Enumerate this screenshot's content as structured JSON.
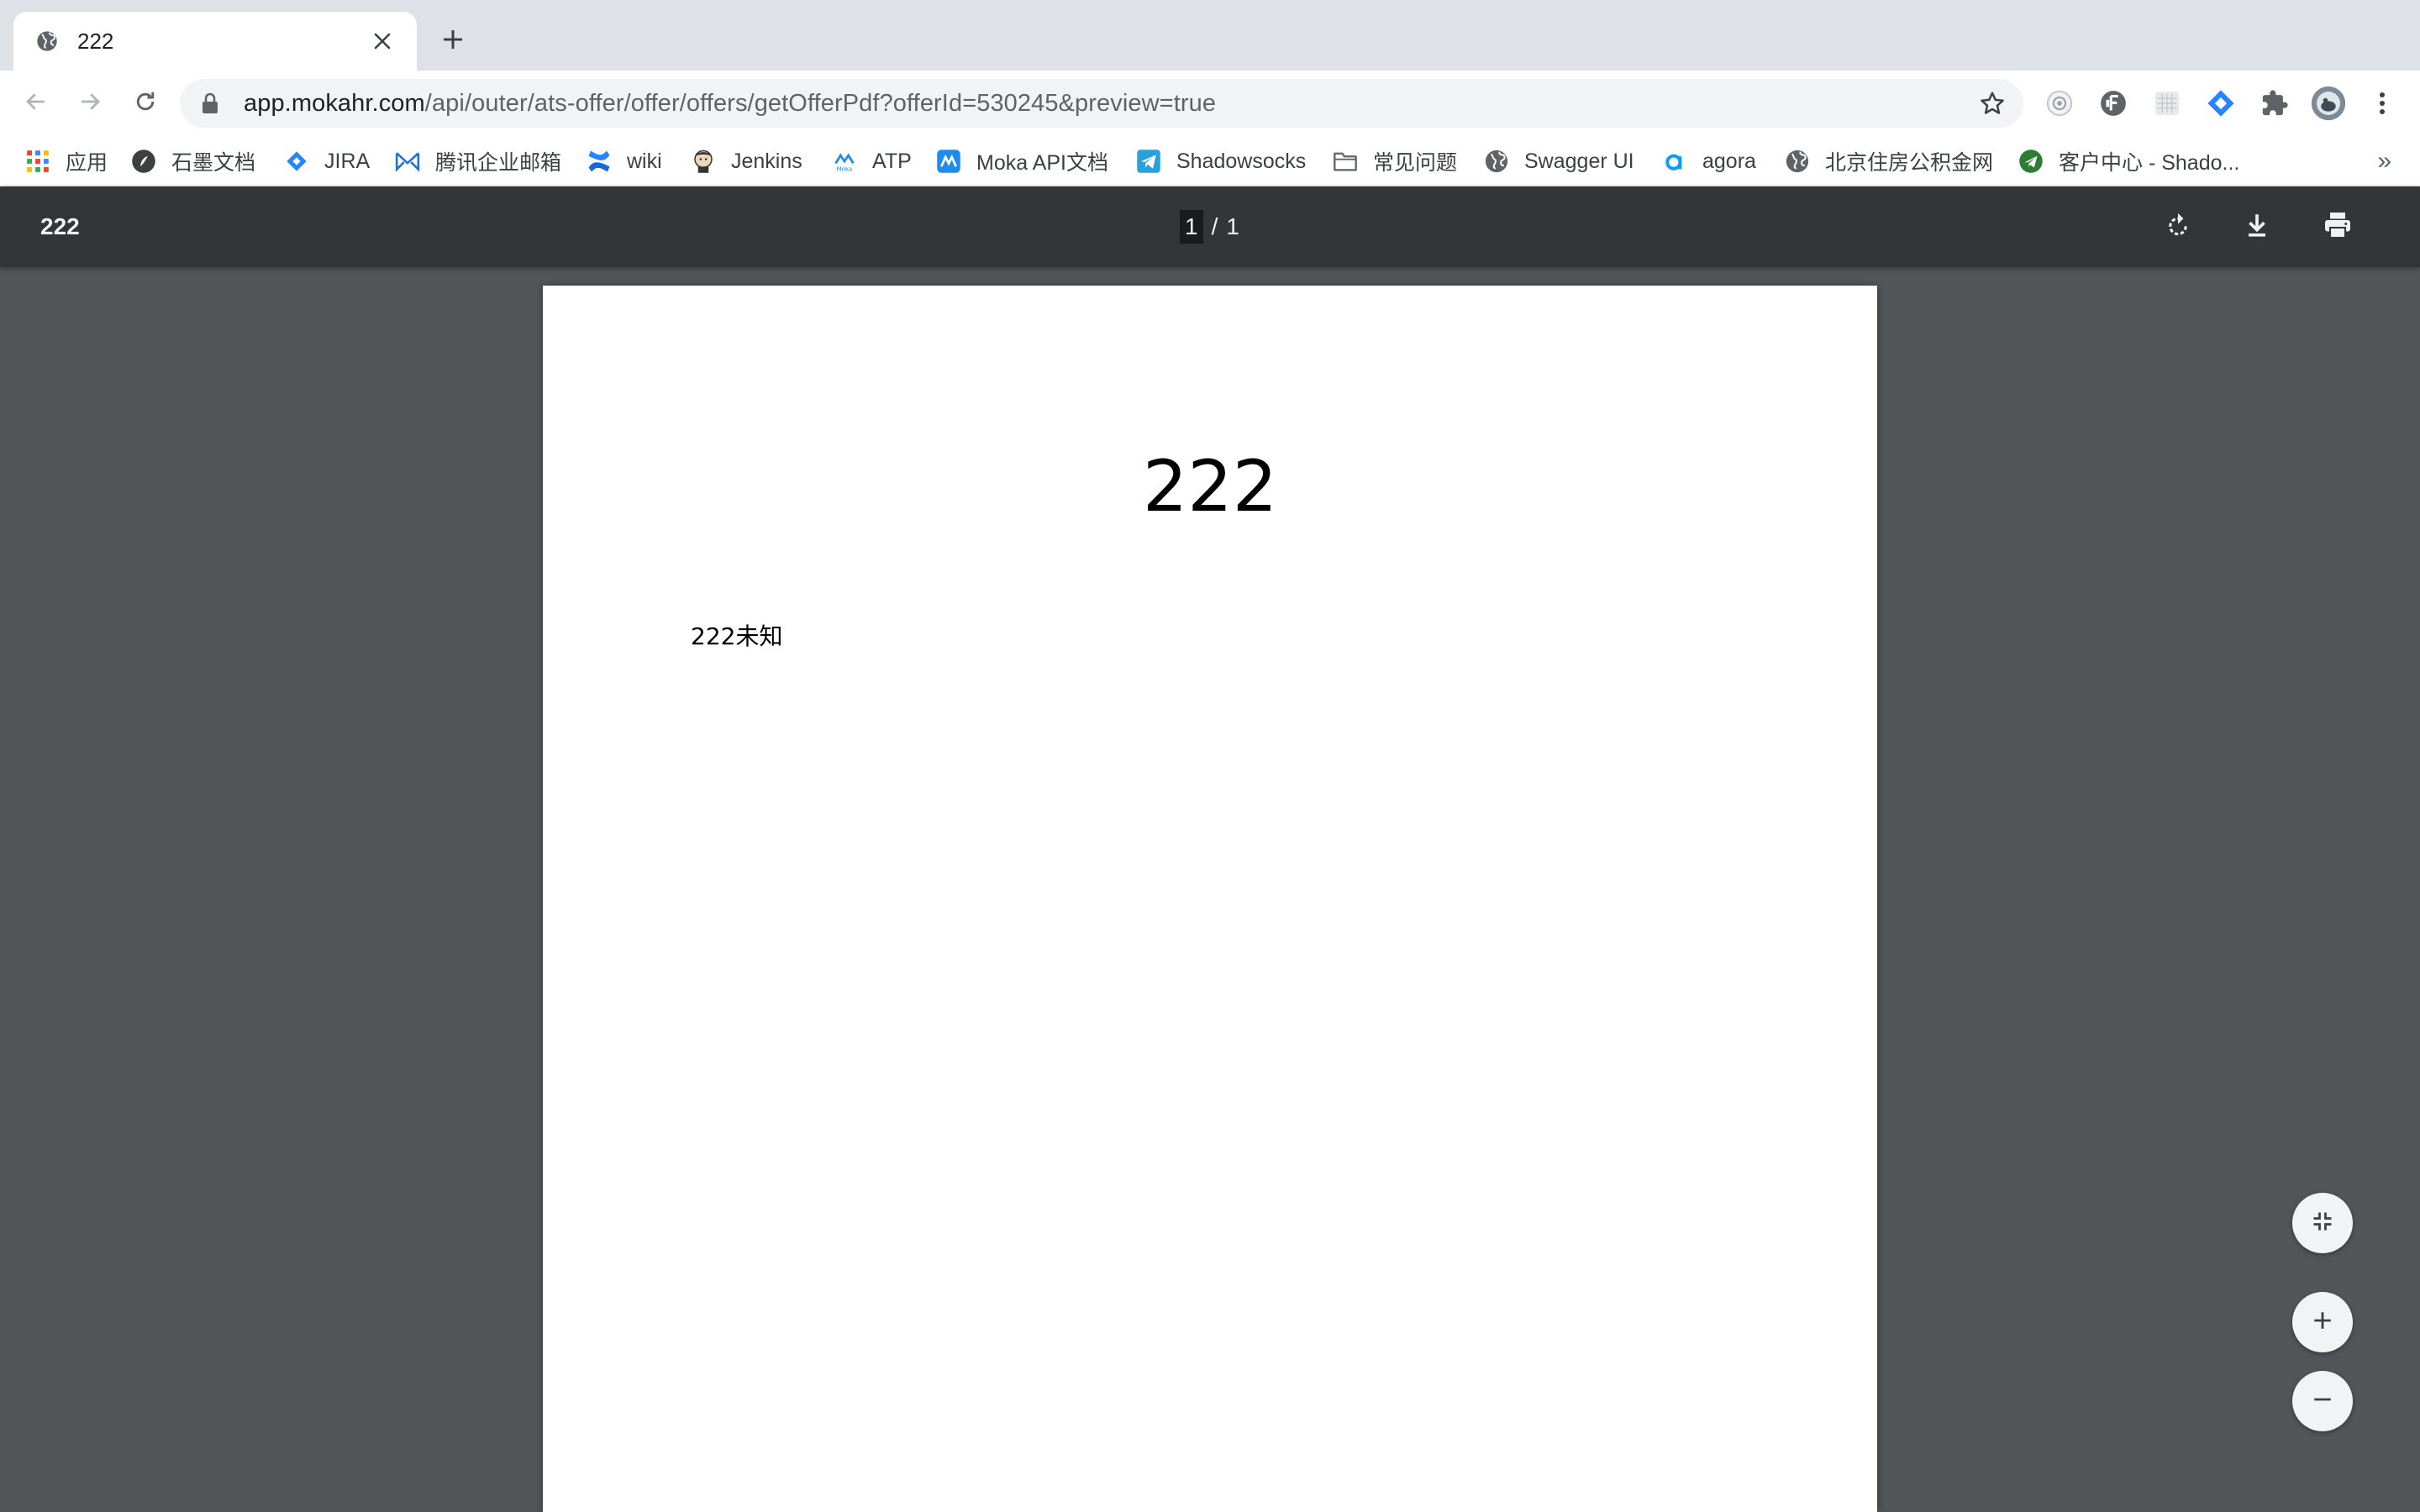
{
  "tab": {
    "title": "222"
  },
  "address_bar": {
    "host": "app.mokahr.com",
    "path": "/api/outer/ats-offer/offer/offers/getOfferPdf?offerId=530245&preview=true"
  },
  "bookmarks": {
    "items": [
      {
        "label": "应用",
        "icon": "apps-grid-icon"
      },
      {
        "label": "石墨文档",
        "icon": "shimo-icon"
      },
      {
        "label": "JIRA",
        "icon": "jira-icon"
      },
      {
        "label": "腾讯企业邮箱",
        "icon": "tencent-mail-icon"
      },
      {
        "label": "wiki",
        "icon": "confluence-icon"
      },
      {
        "label": "Jenkins",
        "icon": "jenkins-icon"
      },
      {
        "label": "ATP",
        "icon": "moka-icon"
      },
      {
        "label": "Moka API文档",
        "icon": "moka-api-icon"
      },
      {
        "label": "Shadowsocks",
        "icon": "telegram-icon"
      },
      {
        "label": "常见问题",
        "icon": "folder-icon"
      },
      {
        "label": "Swagger UI",
        "icon": "globe-icon"
      },
      {
        "label": "agora",
        "icon": "agora-icon"
      },
      {
        "label": "北京住房公积金网",
        "icon": "globe-icon"
      },
      {
        "label": "客户中心 - Shado...",
        "icon": "shadow-icon"
      }
    ],
    "more": "»"
  },
  "pdf_viewer": {
    "title": "222",
    "page_current": "1",
    "page_separator": "/",
    "page_total": "1"
  },
  "document": {
    "heading": "222",
    "body": "222未知"
  },
  "colors": {
    "tabstrip": "#dee1e6",
    "pdf_toolbar": "#323639",
    "viewer_background": "#525659",
    "jira_blue": "#2684ff"
  }
}
